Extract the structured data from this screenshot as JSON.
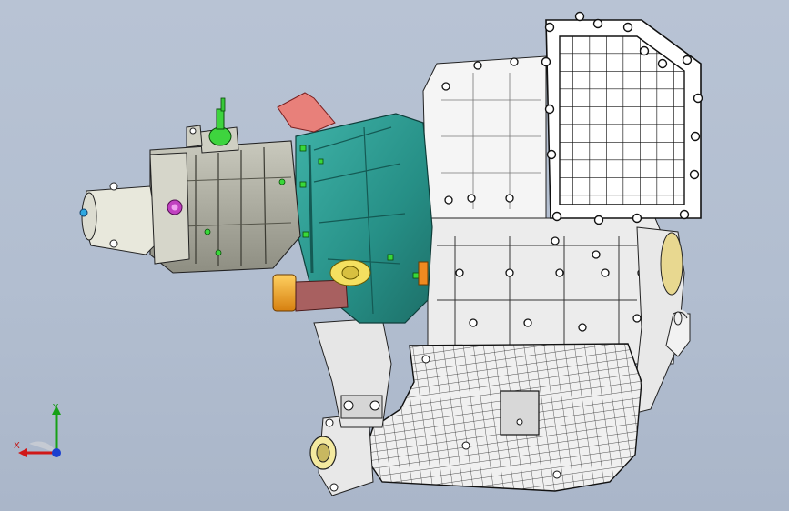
{
  "viewport": {
    "background_top": "#b8c3d4",
    "background_bottom": "#aab6c9",
    "model": "engine-gearbox-assembly"
  },
  "triad": {
    "y_label": "Y",
    "x_label": "X",
    "colors": {
      "x": "#d01818",
      "y": "#16a016",
      "z": "#1a3fd0"
    }
  },
  "palette": {
    "housing_teal": "#2a9a90",
    "block_white": "#f4f4f4",
    "gear_gray": "#b9b9a9",
    "accent_red": "#e08080",
    "bolt_green": "#32c832",
    "starter_orange": "#f0a020"
  }
}
